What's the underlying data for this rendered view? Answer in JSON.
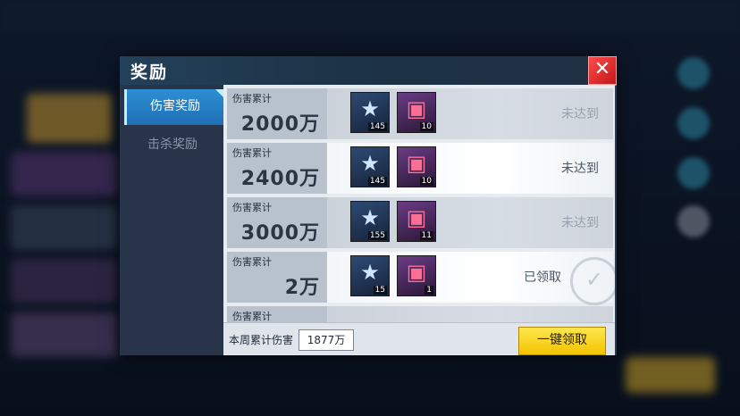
{
  "dialog": {
    "title": "奖励"
  },
  "tabs": [
    {
      "label": "伤害奖励"
    },
    {
      "label": "击杀奖励"
    }
  ],
  "rows": [
    {
      "label": "伤害累计",
      "amount": "2000万",
      "items": [
        {
          "icon": "star-token-icon",
          "count": "145"
        },
        {
          "icon": "pink-chest-icon",
          "count": "10"
        }
      ],
      "status": "未达到"
    },
    {
      "label": "伤害累计",
      "amount": "2400万",
      "items": [
        {
          "icon": "star-token-icon",
          "count": "145"
        },
        {
          "icon": "pink-chest-icon",
          "count": "10"
        }
      ],
      "status": "未达到"
    },
    {
      "label": "伤害累计",
      "amount": "3000万",
      "items": [
        {
          "icon": "star-token-icon",
          "count": "155"
        },
        {
          "icon": "pink-chest-icon",
          "count": "11"
        }
      ],
      "status": "未达到"
    },
    {
      "label": "伤害累计",
      "amount": "2万",
      "items": [
        {
          "icon": "star-token-icon",
          "count": "15"
        },
        {
          "icon": "pink-chest-icon",
          "count": "1"
        }
      ],
      "status": "已领取"
    },
    {
      "label": "伤害累计",
      "amount": "",
      "items": [],
      "status": ""
    }
  ],
  "footer": {
    "label": "本周累计伤害",
    "value": "1877万",
    "claim_label": "一键领取"
  },
  "colors": {
    "accent": "#39c6f0",
    "close": "#e82c2c",
    "claim": "#f7d21a",
    "tab_active": "#2a86cc"
  }
}
